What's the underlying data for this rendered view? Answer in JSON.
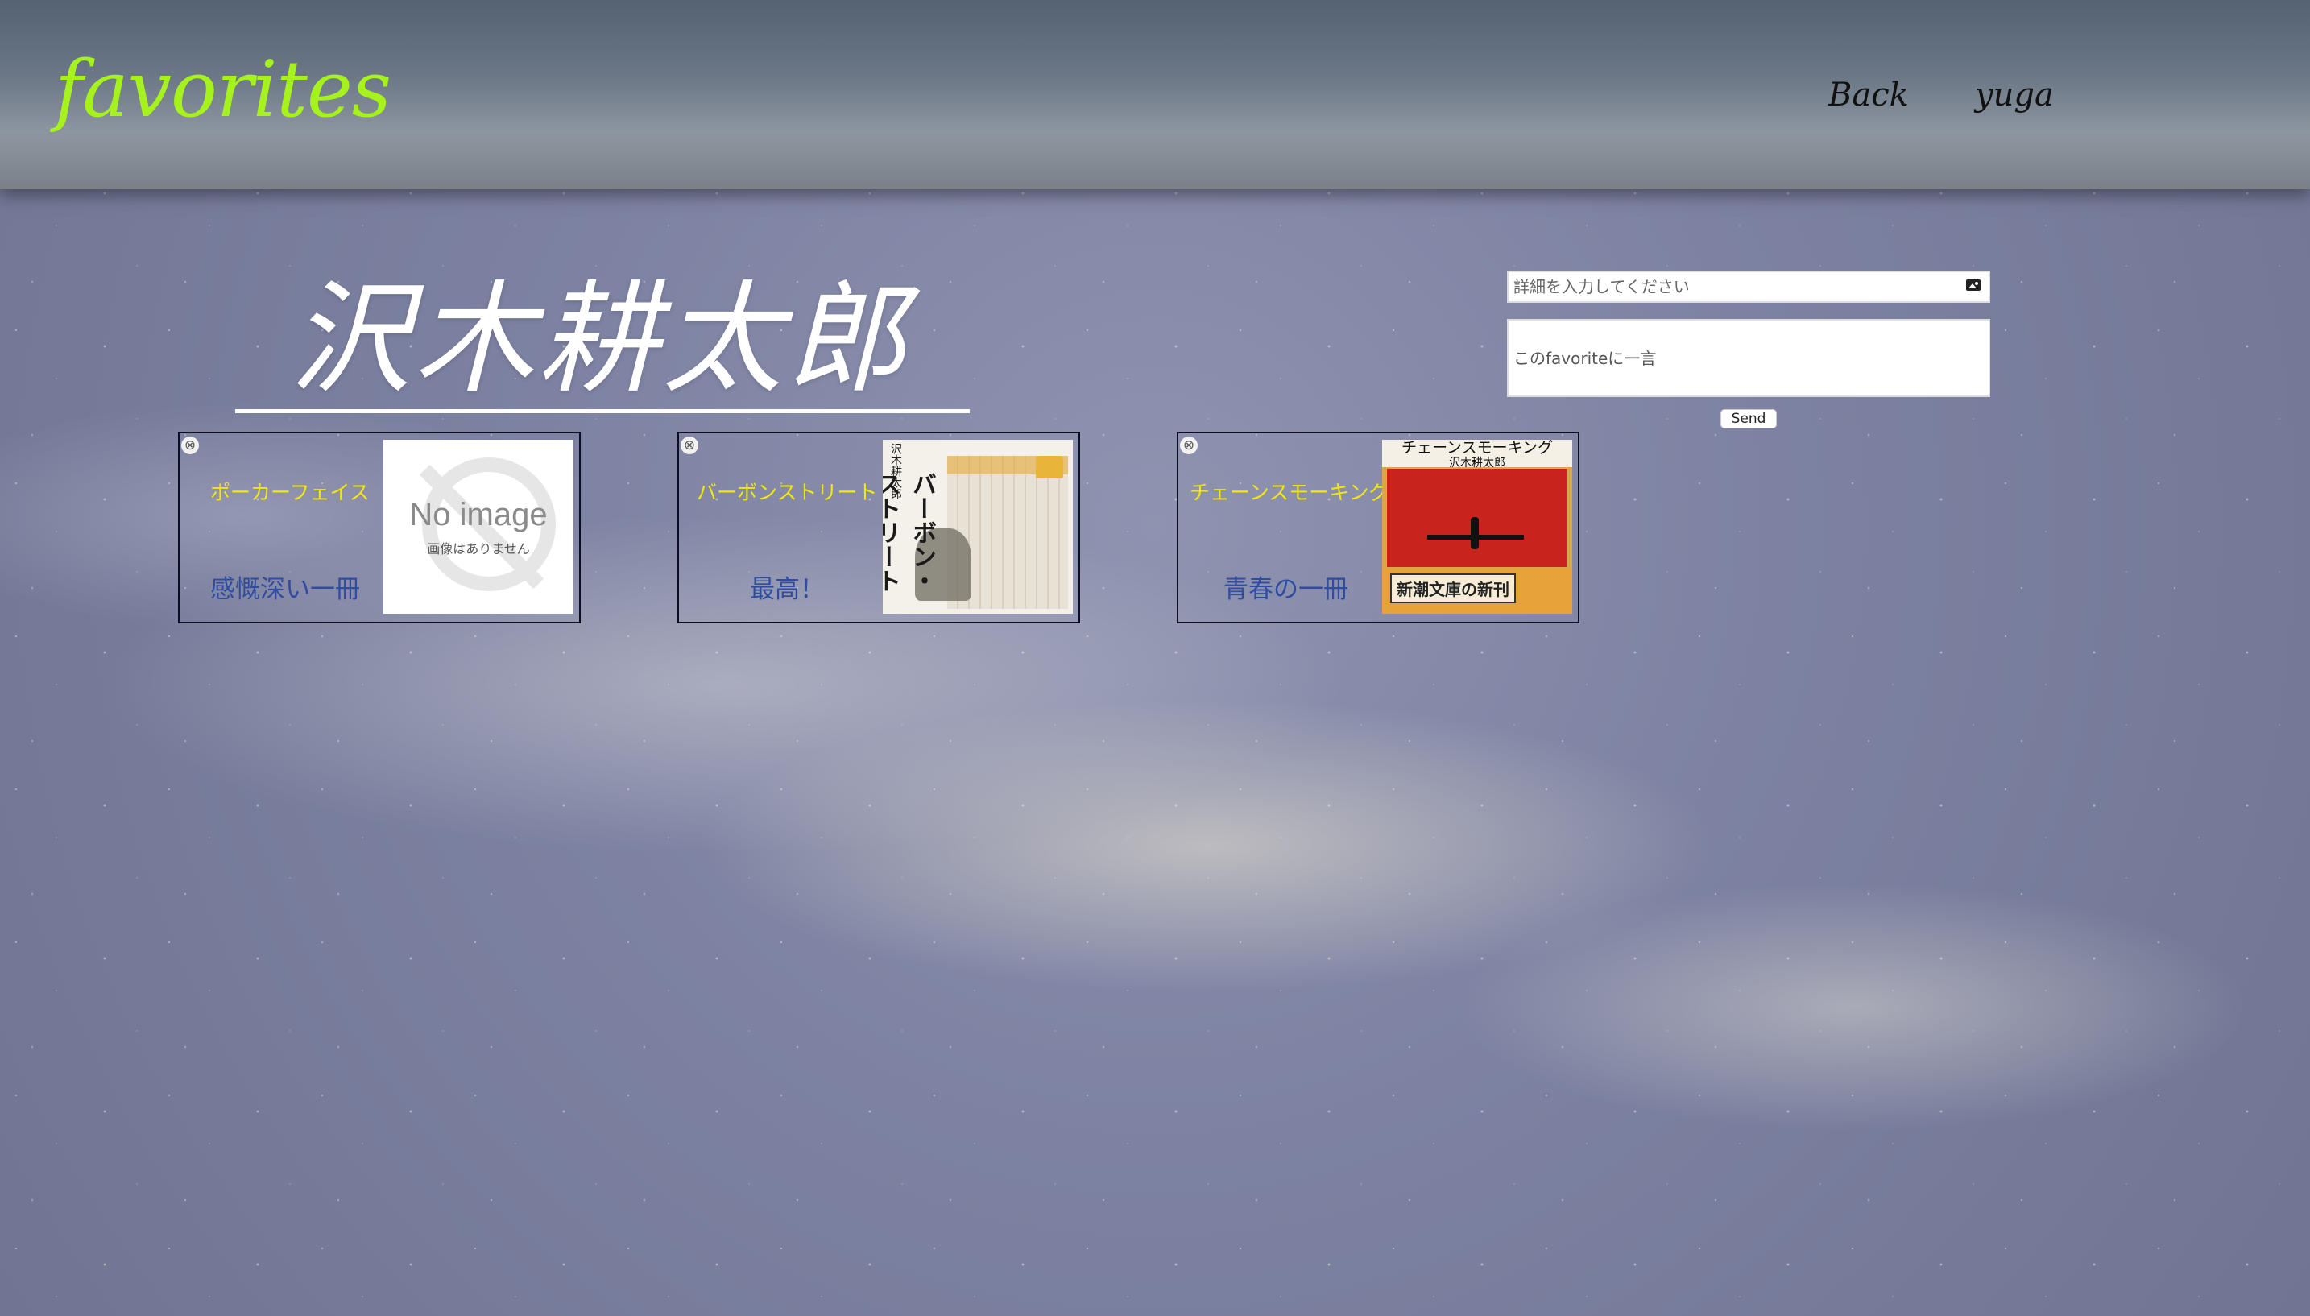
{
  "header": {
    "logo": "favorites",
    "nav": {
      "back": "Back",
      "user": "yuga"
    }
  },
  "author": {
    "name": "沢木耕太郎"
  },
  "form": {
    "detail_placeholder": "詳細を入力してください",
    "image_icon": "image-icon",
    "comment_placeholder": "このfavoriteに一言",
    "send_label": "Send"
  },
  "favorites": [
    {
      "title": "ポーカーフェイス",
      "comment": "感慨深い一冊",
      "cover": {
        "type": "no-image",
        "main": "No image",
        "sub": "画像はありません"
      }
    },
    {
      "title": "バーボンストリート",
      "comment": "最高！",
      "cover": {
        "type": "book",
        "spine": "バーボン・ストリート",
        "author": "沢木耕太郎"
      }
    },
    {
      "title": "チェーンスモーキング",
      "comment": "青春の一冊",
      "cover": {
        "type": "book",
        "title": "チェーンスモーキング",
        "author": "沢木耕太郎",
        "band": "新潮文庫の新刊"
      }
    }
  ],
  "colors": {
    "logo": "#a6f21c",
    "book_title": "#f2e610",
    "book_comment": "#2f4ca0",
    "remove_icon": "close-circle-icon"
  }
}
